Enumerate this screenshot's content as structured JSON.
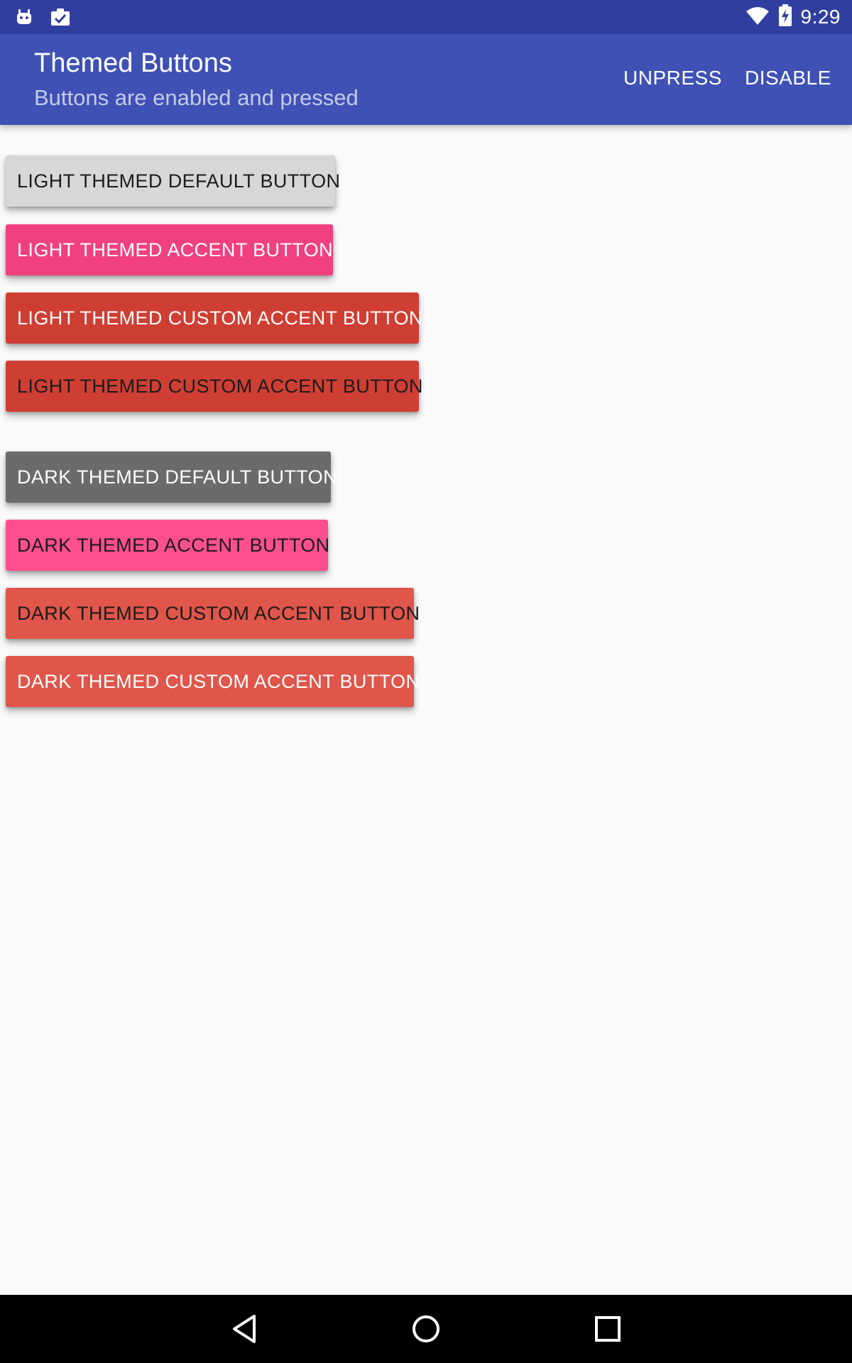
{
  "status_bar": {
    "time": "9:29",
    "icons_left": [
      "android-debug-icon",
      "clipboard-check-icon"
    ],
    "icons_right": [
      "wifi-icon",
      "battery-charging-icon"
    ]
  },
  "app_bar": {
    "title": "Themed Buttons",
    "subtitle": "Buttons are enabled and pressed",
    "actions": {
      "unpress": "UNPRESS",
      "disable": "DISABLE"
    },
    "colors": {
      "background": "#3f51b5",
      "status_bar": "#303f9f"
    }
  },
  "light_group": {
    "buttons": [
      {
        "label": "LIGHT THEMED DEFAULT BUTTON",
        "bg": "#d6d7d7",
        "fg": "#1b1b1b"
      },
      {
        "label": "LIGHT THEMED ACCENT BUTTON",
        "bg": "#f0407f",
        "fg": "#ffffff"
      },
      {
        "label": "LIGHT THEMED CUSTOM ACCENT BUTTON",
        "bg": "#cf3e33",
        "fg": "#ffffff"
      },
      {
        "label": "LIGHT THEMED CUSTOM ACCENT BUTTON",
        "bg": "#cf3e33",
        "fg": "#1b1b1b"
      }
    ]
  },
  "dark_group": {
    "buttons": [
      {
        "label": "DARK THEMED DEFAULT BUTTON",
        "bg": "#6b6b6b",
        "fg": "#ffffff"
      },
      {
        "label": "DARK THEMED ACCENT BUTTON",
        "bg": "#ff4f8f",
        "fg": "#1b1b1b"
      },
      {
        "label": "DARK THEMED CUSTOM ACCENT BUTTON",
        "bg": "#e0564b",
        "fg": "#1b1b1b"
      },
      {
        "label": "DARK THEMED CUSTOM ACCENT BUTTON",
        "bg": "#e0564b",
        "fg": "#ffffff"
      }
    ]
  },
  "nav_bar": {
    "items": [
      "back-icon",
      "home-icon",
      "recents-icon"
    ]
  }
}
